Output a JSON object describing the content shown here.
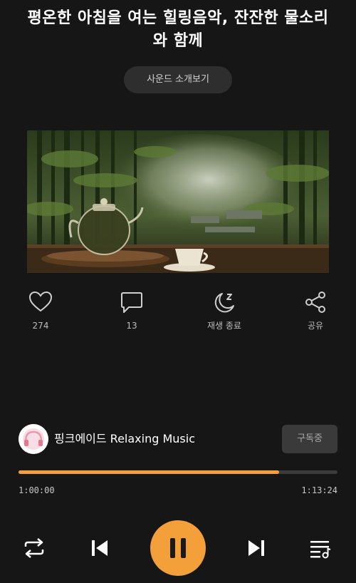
{
  "track": {
    "title": "평온한 아침을 여는 힐링음악, 잔잔한 물소리와 함께",
    "intro_button": "사운드 소개보기"
  },
  "actions": {
    "like": {
      "icon": "heart-icon",
      "label": "274"
    },
    "comment": {
      "icon": "comment-icon",
      "label": "13"
    },
    "sleep_timer": {
      "icon": "moon-sleep-icon",
      "label": "재생 종료"
    },
    "share": {
      "icon": "share-icon",
      "label": "공유"
    }
  },
  "channel": {
    "name": "핑크에이드 Relaxing Music",
    "subscribe_label": "구독중"
  },
  "playback": {
    "elapsed": "1:00:00",
    "total": "1:13:24",
    "progress": 0.818
  },
  "controls": {
    "repeat": "repeat-icon",
    "previous": "skip-previous-icon",
    "play_pause": "pause-icon",
    "next": "skip-next-icon",
    "playlist": "playlist-icon"
  },
  "colors": {
    "accent": "#f4a03a",
    "background": "#161616"
  }
}
